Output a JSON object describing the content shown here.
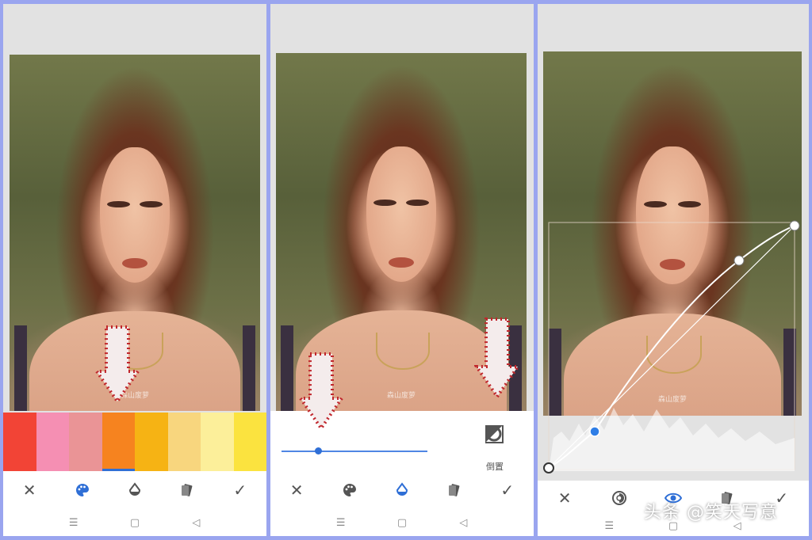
{
  "panel1": {
    "swatch_colors": [
      "#f24436",
      "#f58fb3",
      "#ea9496",
      "#f6831f",
      "#f6b314",
      "#f8d67e",
      "#fcef9a",
      "#fbe33f"
    ],
    "selected_swatch": 3,
    "watermark": "森山废萝",
    "toolbar": [
      "close-icon",
      "palette-icon",
      "drop-icon",
      "styles-icon",
      "check-icon"
    ],
    "active_tool": "palette-icon"
  },
  "panel2": {
    "slider_value": 0.25,
    "invert_label": "倒置",
    "watermark": "森山废萝",
    "toolbar": [
      "close-icon",
      "palette-icon",
      "drop-icon",
      "styles-icon",
      "check-icon"
    ],
    "active_tool": "drop-icon"
  },
  "panel3": {
    "watermark": "森山废萝",
    "toolbar": [
      "close-icon",
      "tone-icon",
      "eye-icon",
      "styles-icon",
      "check-icon"
    ],
    "active_tool": "eye-icon"
  },
  "nav_icons": [
    "menu-icon",
    "home-icon",
    "back-icon"
  ],
  "nav_glyphs": {
    "menu": "☰",
    "home": "▢",
    "back": "◁"
  },
  "toolbar_glyphs": {
    "close": "✕",
    "check": "✓"
  },
  "accent_color": "#2f6fd6",
  "caption": "头条 @笑天写意"
}
